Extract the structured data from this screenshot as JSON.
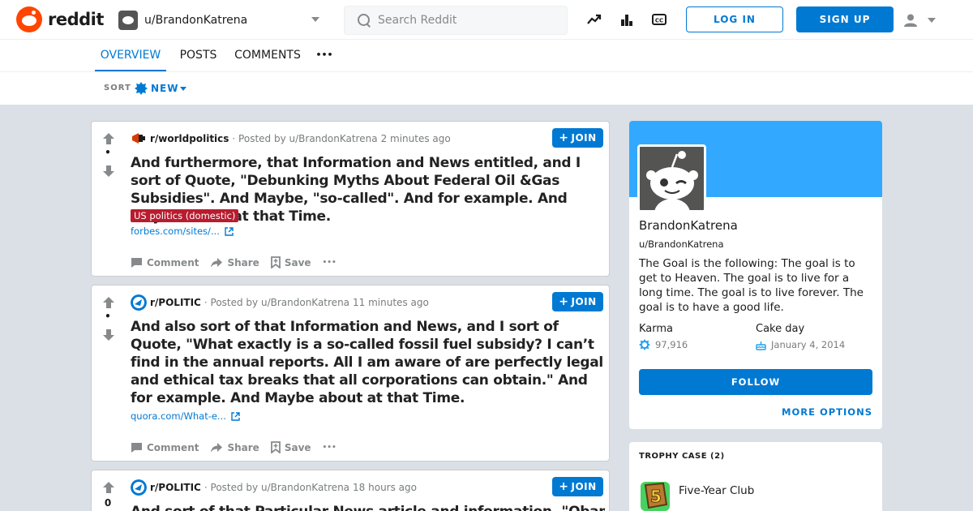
{
  "header": {
    "logo_text": "reddit",
    "current_user": "u/BrandonKatrena",
    "search_placeholder": "Search Reddit",
    "login_label": "LOG IN",
    "signup_label": "SIGN UP"
  },
  "tabs": [
    {
      "label": "OVERVIEW",
      "active": true
    },
    {
      "label": "POSTS",
      "active": false
    },
    {
      "label": "COMMENTS",
      "active": false
    },
    {
      "label": "•••",
      "active": false
    }
  ],
  "sort": {
    "label": "SORT",
    "value": "NEW"
  },
  "posts": [
    {
      "subreddit": "r/worldpolitics",
      "posted_by": "· Posted by u/BrandonKatrena",
      "time": "2 minutes ago",
      "join_label": "JOIN",
      "score": "•",
      "title": "And furthermore, that Information and News entitled, and I sort of Quote, \"Debunking Myths About Federal Oil &Gas Subsidies\". And Maybe, \"so-called\". And for example. And Maybe about at that Time.",
      "flair": "US politics (domestic)",
      "link": "forbes.com/sites/...",
      "actions": {
        "comment": "Comment",
        "share": "Share",
        "save": "Save",
        "more": "•••"
      }
    },
    {
      "subreddit": "r/POLITIC",
      "posted_by": "· Posted by u/BrandonKatrena",
      "time": "11 minutes ago",
      "join_label": "JOIN",
      "score": "•",
      "title": "And also sort of that Information and News, and I sort of Quote, \"What exactly is a so-called fossil fuel subsidy? I can’t find in the annual reports. All I am aware of are perfectly legal and ethical tax breaks that all corporations can obtain.\" And for example. And Maybe about at that Time.",
      "link": "quora.com/What-e...",
      "actions": {
        "comment": "Comment",
        "share": "Share",
        "save": "Save",
        "more": "•••"
      }
    },
    {
      "subreddit": "r/POLITIC",
      "posted_by": "· Posted by u/BrandonKatrena",
      "time": "18 hours ago",
      "join_label": "JOIN",
      "score": "0",
      "title": "And sort of that Particular News article and information, \"Obama's"
    }
  ],
  "profile": {
    "display_name": "BrandonKatrena",
    "username": "u/BrandonKatrena",
    "description": "The Goal is the following: The goal is to get to Heaven. The goal is to live for a long time. The goal is to live forever. The goal is to have a good life.",
    "karma_label": "Karma",
    "karma_value": "97,916",
    "cakeday_label": "Cake day",
    "cakeday_value": "January 4, 2014",
    "follow_label": "FOLLOW",
    "more_options_label": "MORE OPTIONS"
  },
  "trophy_case": {
    "title": "TROPHY CASE (2)",
    "items": [
      {
        "name": "Five-Year Club",
        "icon": "five-year-club-icon"
      }
    ]
  },
  "colors": {
    "accent": "#0079d3",
    "brand": "#ff4500",
    "banner": "#33a8ff",
    "flair": "#b81c2e",
    "background": "#dae0e6"
  }
}
